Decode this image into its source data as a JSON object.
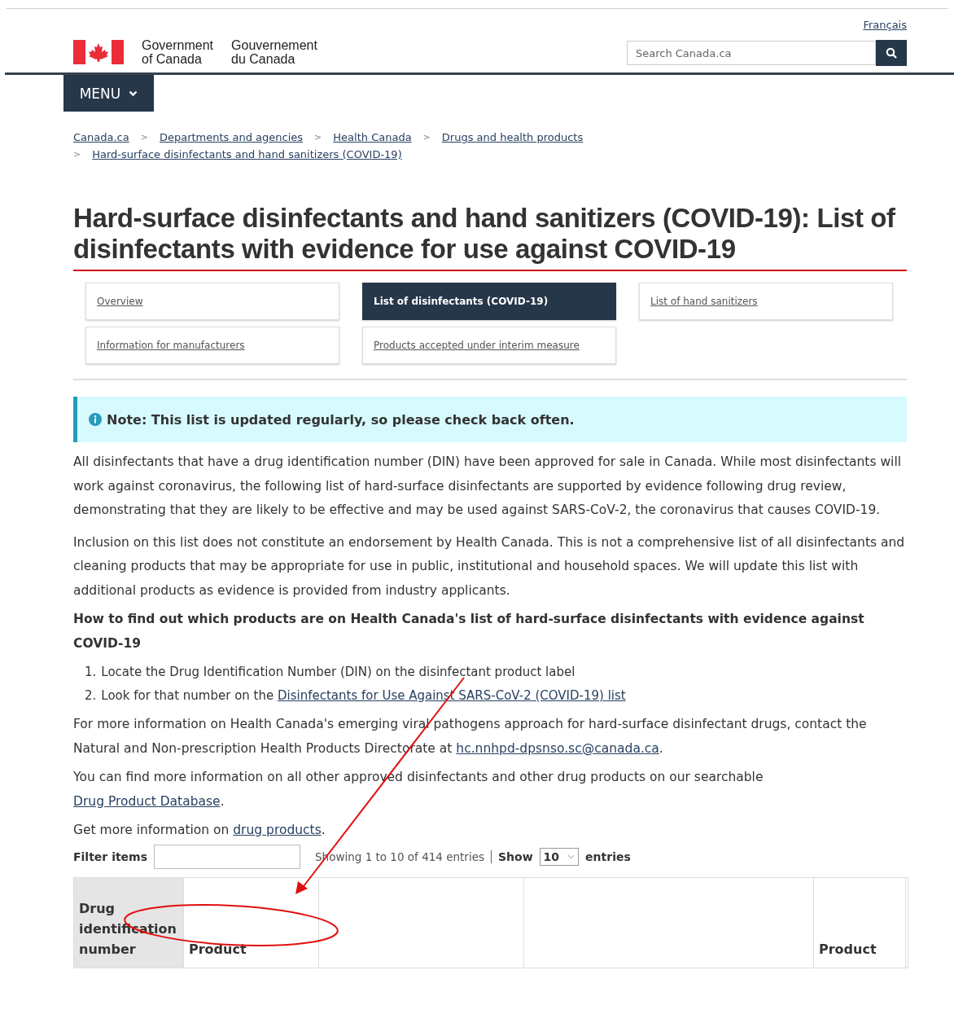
{
  "header": {
    "language_link": "Français",
    "gov_en": [
      "Government",
      "of Canada"
    ],
    "gov_fr": [
      "Gouvernement",
      "du Canada"
    ],
    "search": {
      "placeholder": "Search Canada.ca"
    },
    "menu": "MENU"
  },
  "breadcrumbs": [
    {
      "label": "Canada.ca"
    },
    {
      "separator": ">",
      "label": "Departments and agencies"
    },
    {
      "separator": ">",
      "label": "Health Canada"
    },
    {
      "separator": ">",
      "label": "Drugs and health products"
    },
    {
      "separator": ">",
      "label": "Hard-surface disinfectants and hand sanitizers (COVID-19)"
    }
  ],
  "title": "Hard-surface disinfectants and hand sanitizers (COVID-19): List of disinfectants with evidence for use against COVID-19",
  "tabs": [
    {
      "label": "Overview",
      "selected": false
    },
    {
      "label": "List of disinfectants (COVID-19)",
      "selected": true
    },
    {
      "label": "List of hand sanitizers",
      "selected": false
    },
    {
      "label": "Information for manufacturers",
      "selected": false
    },
    {
      "label": "Products accepted under interim measure",
      "selected": false
    }
  ],
  "note": "Note: This list is updated regularly, so please check back often.",
  "paragraphs": [
    [
      {
        "text": "All disinfectants that have a drug identification number (DIN) have been approved for sale in Canada. While most disinfectants will work against coronavirus, the following list of hard-surface disinfectants are supported by evidence following drug review, demonstrating that they are likely to be effective and may be used against SARS-CoV-2, the coronavirus that causes COVID-19."
      }
    ],
    [
      {
        "text": "Inclusion on this list does not constitute an endorsement by Health Canada. This is not a comprehensive list of all disinfectants and cleaning products that may be appropriate for use in public, institutional and household spaces. We will update this list with additional products as evidence is provided from industry applicants."
      }
    ]
  ],
  "how_to": {
    "heading": "How to find out which products are on Health Canada's list of hard-surface disinfectants with evidence against COVID-19",
    "markers": [
      "1.",
      "2."
    ],
    "steps": [
      [
        {
          "text": "Locate the Drug Identification Number (DIN) on the disinfectant product label"
        }
      ],
      [
        {
          "text": "Look for that number on the "
        },
        {
          "link": "Disinfectants for Use Against SARS-CoV-2 (COVID-19) list"
        }
      ]
    ]
  },
  "more": [
    [
      {
        "text": "For more information on Health Canada's emerging viral pathogens approach for hard-surface disinfectant drugs, contact the Natural and Non-prescription Health Products Directorate at "
      },
      {
        "link": "hc.nnhpd-dpsnso.sc@canada.ca"
      },
      {
        "text": "."
      }
    ],
    [
      {
        "text": "You can find more information on all other approved disinfectants and other drug products on our searchable "
      },
      {
        "link": "Drug Product Database"
      },
      {
        "text": "."
      }
    ],
    [
      {
        "text": "Get more information on "
      },
      {
        "link": "drug products"
      },
      {
        "text": "."
      }
    ]
  ],
  "table_controls": {
    "filter_label": "Filter items",
    "info": "Showing 1 to 10 of 414 entries",
    "show_label": "Show",
    "show_value": "10",
    "entries_label": "entries"
  },
  "table": {
    "columns": [
      {
        "label": "Drug identification number",
        "shaded": true
      },
      {
        "label": "Product",
        "shaded": false
      },
      {
        "shaded": false
      },
      {
        "shaded": false
      },
      {
        "label": "Product",
        "shaded": false
      }
    ]
  }
}
